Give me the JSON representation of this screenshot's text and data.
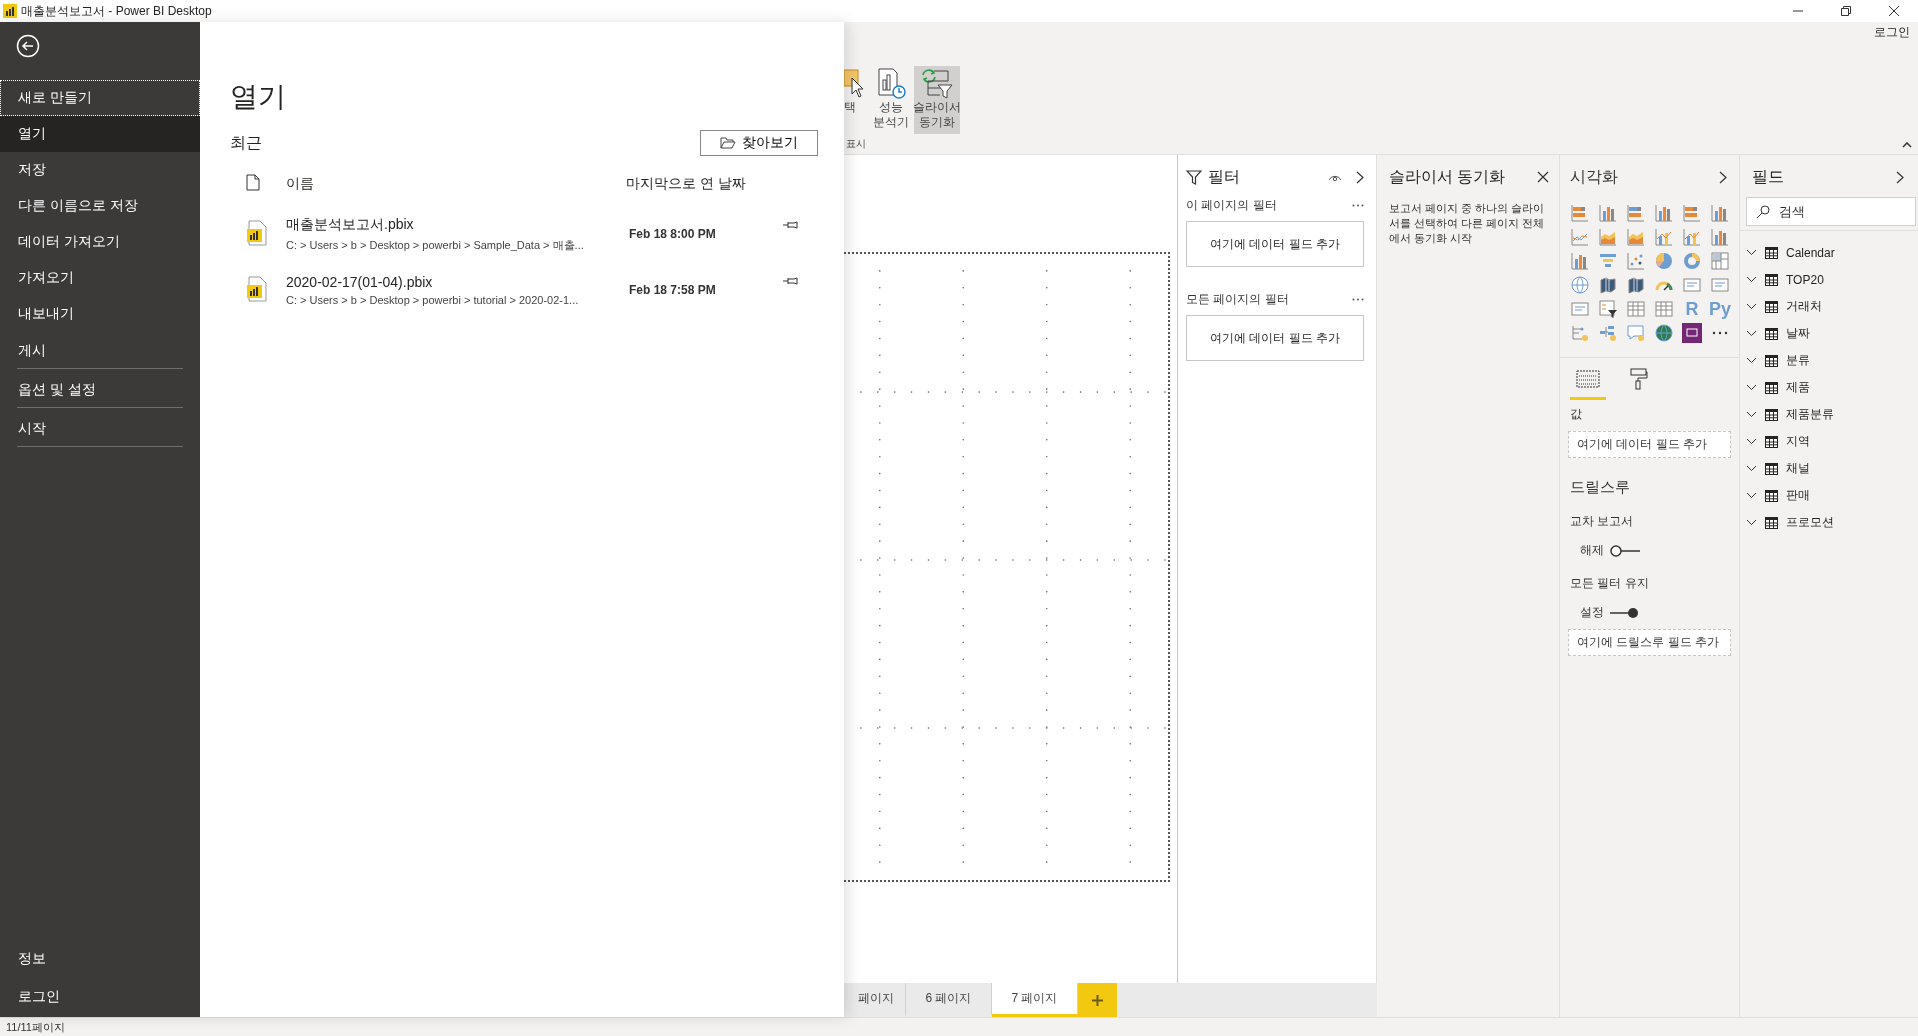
{
  "window": {
    "title": "매출분석보고서 - Power BI Desktop",
    "sign_in": "로그인"
  },
  "backstage": {
    "menu": [
      {
        "label": "새로 만들기",
        "selected": false,
        "focused": true,
        "separated": false
      },
      {
        "label": "열기",
        "selected": true,
        "focused": false,
        "separated": false
      },
      {
        "label": "저장",
        "selected": false,
        "focused": false,
        "separated": false
      },
      {
        "label": "다른 이름으로 저장",
        "selected": false,
        "focused": false,
        "separated": false
      },
      {
        "label": "데이터 가져오기",
        "selected": false,
        "focused": false,
        "separated": false
      },
      {
        "label": "가져오기",
        "selected": false,
        "focused": false,
        "separated": false
      },
      {
        "label": "내보내기",
        "selected": false,
        "focused": false,
        "separated": false
      },
      {
        "label": "게시",
        "selected": false,
        "focused": false,
        "separated": true
      },
      {
        "label": "옵션 및 설정",
        "selected": false,
        "focused": false,
        "separated": true
      },
      {
        "label": "시작",
        "selected": false,
        "focused": false,
        "separated": true
      }
    ],
    "menu_bottom": [
      {
        "label": "정보"
      },
      {
        "label": "로그인"
      }
    ]
  },
  "open_panel": {
    "title": "열기",
    "section": "최근",
    "browse_button": "찾아보기",
    "columns": [
      "이름",
      "마지막으로 연 날짜"
    ],
    "files": [
      {
        "name": "매출분석보고서.pbix",
        "path": "C: > Users > b > Desktop > powerbi > Sample_Data > 매출...",
        "date": "Feb 18 8:00 PM"
      },
      {
        "name": "2020-02-17(01-04).pbix",
        "path": "C: > Users > b > Desktop > powerbi > tutorial > 2020-02-1...",
        "date": "Feb 18 7:58 PM"
      }
    ]
  },
  "ribbon": {
    "buttons": [
      {
        "kind": "select",
        "label": "택",
        "selected": false
      },
      {
        "kind": "performance",
        "label": "성능 분석기",
        "selected": false
      },
      {
        "kind": "sync",
        "label": "슬라이서 동기화",
        "selected": true
      }
    ],
    "group_label": "표시"
  },
  "page_tabs": [
    {
      "label": "페이지",
      "selected": false
    },
    {
      "label": "6 페이지",
      "selected": false
    },
    {
      "label": "7 페이지",
      "selected": true
    }
  ],
  "filters": {
    "title": "필터",
    "sections": [
      {
        "label": "이 페이지의 필터",
        "drop": "여기에 데이터 필드 추가"
      },
      {
        "label": "모든 페이지의 필터",
        "drop": "여기에 데이터 필드 추가"
      }
    ]
  },
  "slicer_sync": {
    "title": "슬라이서 동기화",
    "text": "보고서 페이지 중 하나의 슬라이서를 선택하여 다른 페이지 전체에서 동기화 시작"
  },
  "visualizations": {
    "title": "시각화",
    "items": [
      {
        "kind": "hbar"
      },
      {
        "kind": "column"
      },
      {
        "kind": "hbar"
      },
      {
        "kind": "column"
      },
      {
        "kind": "hbar"
      },
      {
        "kind": "column"
      },
      {
        "kind": "line"
      },
      {
        "kind": "area"
      },
      {
        "kind": "area"
      },
      {
        "kind": "combo"
      },
      {
        "kind": "combo"
      },
      {
        "kind": "column"
      },
      {
        "kind": "column"
      },
      {
        "kind": "funnel"
      },
      {
        "kind": "scatter"
      },
      {
        "kind": "pie"
      },
      {
        "kind": "donut"
      },
      {
        "kind": "treemap"
      },
      {
        "kind": "globe"
      },
      {
        "kind": "map"
      },
      {
        "kind": "map"
      },
      {
        "kind": "gauge"
      },
      {
        "kind": "card"
      },
      {
        "kind": "card"
      },
      {
        "kind": "card"
      },
      {
        "kind": "slicer"
      },
      {
        "kind": "table"
      },
      {
        "kind": "table"
      },
      {
        "kind": "letter",
        "label": "R"
      },
      {
        "kind": "letter",
        "label": "Py"
      },
      {
        "kind": "influencer"
      },
      {
        "kind": "tree"
      },
      {
        "kind": "qna"
      },
      {
        "kind": "globe"
      },
      {
        "kind": "apps"
      },
      {
        "kind": "more"
      }
    ],
    "tabs": [
      {
        "kind": "fields",
        "selected": true
      },
      {
        "kind": "format",
        "selected": false
      }
    ],
    "values_label": "값",
    "values_drop": "여기에 데이터 필드 추가",
    "drill_title": "드릴스루",
    "toggles": [
      {
        "label": "교차 보고서",
        "state_label": "해제",
        "on": false
      },
      {
        "label": "모든 필터 유지",
        "state_label": "설정",
        "on": true
      }
    ],
    "drill_drop": "여기에 드릴스루 필드 추가"
  },
  "fields": {
    "title": "필드",
    "search": {
      "placeholder": "검색"
    },
    "tables": [
      {
        "name": "Calendar"
      },
      {
        "name": "TOP20"
      },
      {
        "name": "거래처"
      },
      {
        "name": "날짜"
      },
      {
        "name": "분류"
      },
      {
        "name": "제품"
      },
      {
        "name": "제품분류"
      },
      {
        "name": "지역"
      },
      {
        "name": "채널"
      },
      {
        "name": "판매"
      },
      {
        "name": "프로모션"
      }
    ]
  },
  "status_bar": "11/11페이지"
}
